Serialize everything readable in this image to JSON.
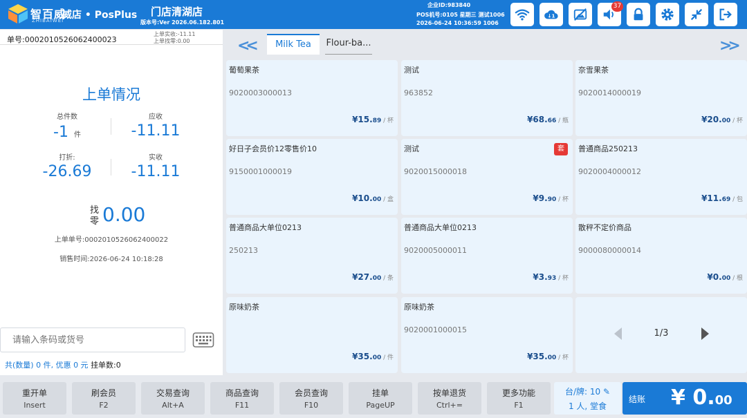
{
  "header": {
    "brand": "智百威",
    "brand_sub": "ZHIBAIWEI",
    "app_name": "威店 • PosPlus",
    "store_name": "门店清湖店",
    "version": "版本号:Ver 2026.06.182.801",
    "enterprise_id": "企业ID:983840",
    "pos_line": "POS机号:0105  星期三   测试1006",
    "datetime_line": "2026-06-24 10:36:59   1006",
    "notification_count": "37",
    "icons": [
      "wifi-icon",
      "cloud-sync-icon",
      "no-image-icon",
      "speaker-icon",
      "lock-icon",
      "gear-icon",
      "collapse-icon",
      "exit-icon"
    ]
  },
  "left": {
    "order_no": "单号:0002010526062400023",
    "last_receipt": "上单实收:-11.11",
    "last_change": "上单找零:0.00",
    "summary_title": "上单情况",
    "total_count_label": "总件数",
    "total_count_value": "-1",
    "count_unit": "件",
    "receivable_label": "应收",
    "receivable_value": "-11.11",
    "discount_label": "打折:",
    "discount_value": "-26.69",
    "actual_label": "实收",
    "actual_value": "-11.11",
    "change_label": "找零",
    "change_value": "0.00",
    "prev_order": "上单单号:0002010526062400022",
    "sale_time": "销售时间:2026-06-24 10:18:28",
    "barcode_placeholder": "请输入条码或货号",
    "footer_total": "共(数量) 0 件, 优惠 0 元",
    "footer_held": "挂单数:0"
  },
  "tabs": [
    {
      "label": "Milk Tea",
      "active": true
    },
    {
      "label": "Flour-ba...",
      "active": false
    }
  ],
  "products": [
    {
      "name": "葡萄果茶",
      "code": "9020003000013",
      "price_int": "¥15.",
      "price_dec": "89",
      "unit": "/ 杯",
      "tag": ""
    },
    {
      "name": "测试",
      "code": "963852",
      "price_int": "¥68.",
      "price_dec": "66",
      "unit": "/ 瓶",
      "tag": ""
    },
    {
      "name": "奈雪果茶",
      "code": "9020014000019",
      "price_int": "¥20.",
      "price_dec": "00",
      "unit": "/ 杯",
      "tag": ""
    },
    {
      "name": "好日子会员价12零售价10",
      "code": "9150001000019",
      "price_int": "¥10.",
      "price_dec": "00",
      "unit": "/ 盒",
      "tag": ""
    },
    {
      "name": "测试",
      "code": "9020015000018",
      "price_int": "¥9.",
      "price_dec": "90",
      "unit": "/ 杯",
      "tag": "套"
    },
    {
      "name": "普通商品250213",
      "code": "9020004000012",
      "price_int": "¥11.",
      "price_dec": "69",
      "unit": "/ 包",
      "tag": ""
    },
    {
      "name": "普通商品大单位0213",
      "code": "250213",
      "price_int": "¥27.",
      "price_dec": "00",
      "unit": "/ 条",
      "tag": ""
    },
    {
      "name": "普通商品大单位0213",
      "code": "9020005000011",
      "price_int": "¥3.",
      "price_dec": "93",
      "unit": "/ 杯",
      "tag": ""
    },
    {
      "name": "散秤不定价商品",
      "code": "9000080000014",
      "price_int": "¥0.",
      "price_dec": "00",
      "unit": "/ 根",
      "tag": ""
    },
    {
      "name": "原味奶茶",
      "code": "",
      "price_int": "¥35.",
      "price_dec": "00",
      "unit": "/ 件",
      "tag": ""
    },
    {
      "name": "原味奶茶",
      "code": "9020001000015",
      "price_int": "¥35.",
      "price_dec": "00",
      "unit": "/ 杯",
      "tag": ""
    }
  ],
  "pager": {
    "label": "1/3"
  },
  "bottom": {
    "buttons": [
      {
        "label": "重开单",
        "key": "Insert"
      },
      {
        "label": "刷会员",
        "key": "F2"
      },
      {
        "label": "交易查询",
        "key": "Alt+A"
      },
      {
        "label": "商品查询",
        "key": "F11"
      },
      {
        "label": "会员查询",
        "key": "F10"
      },
      {
        "label": "挂单",
        "key": "PageUP"
      },
      {
        "label": "按单退货",
        "key": "Ctrl+="
      },
      {
        "label": "更多功能",
        "key": "F1"
      }
    ],
    "table_label": "台/牌: 10 ✎",
    "people_label": "1 人,  堂食",
    "checkout_label": "结账",
    "checkout_amount_int": "¥ 0.",
    "checkout_amount_dec": "00"
  },
  "colors": {
    "primary": "#1a7ad6",
    "card_bg": "#eaf4fd",
    "alert": "#e53935"
  }
}
